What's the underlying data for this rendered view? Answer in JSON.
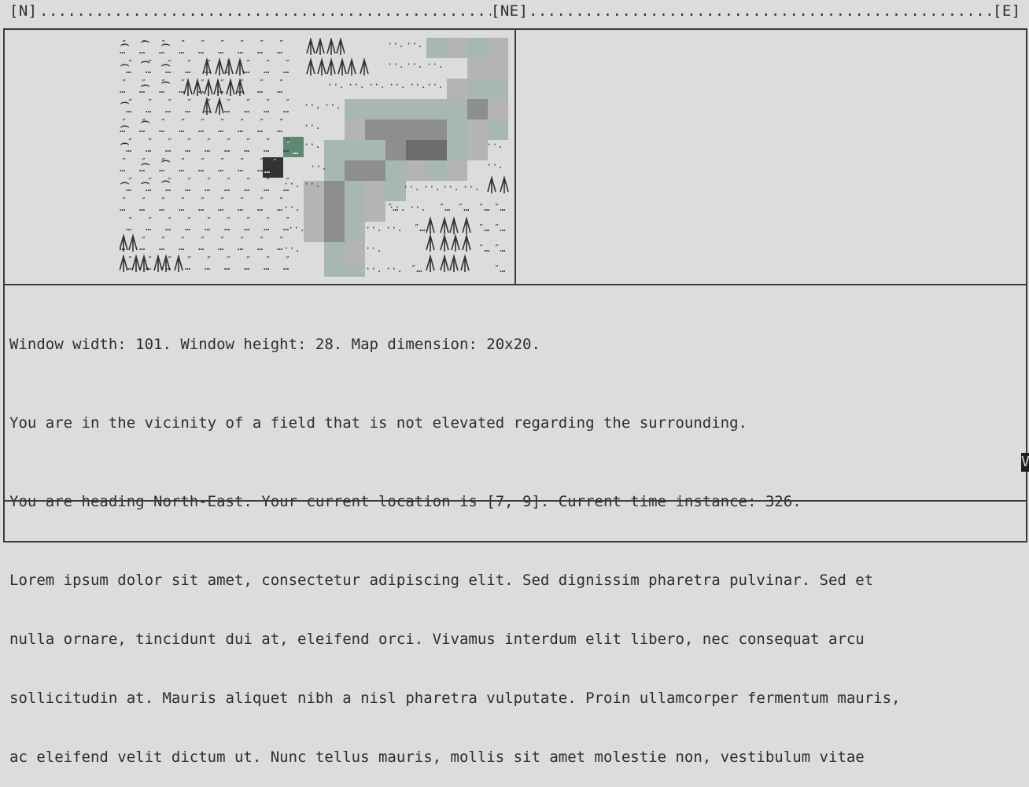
{
  "compass": {
    "left": "[N]",
    "center": "[NE]",
    "right": "[E]"
  },
  "map": {
    "dimension": "20x20",
    "rows": [
      "hhhhg ggggtttt gg ddddd",
      "hhhhgtttg gg tttt. ddddd",
      "hhhgtttt  gg  ddddddddd",
      "hhggtt ggg gg dd",
      "hgggggggg gggdd",
      "hggggggggg gPdd",
      "hhhhgggg gXdd",
      "hhhhggggggd",
      "gggggggggd",
      "gggggggggd",
      "tgggggggddd",
      "ttttggggggdd"
    ]
  },
  "info": {
    "dimensions_line": "Window width: 101. Window height: 28. Map dimension: 20x20.",
    "vicinity_line": "You are in the vicinity of a field that is not elevated regarding the surrounding.",
    "heading_line": "You are heading North-East. Your current location is [7, 9]. Current time instance: 326.",
    "lorem_lines": [
      "Lorem ipsum dolor sit amet, consectetur adipiscing elit. Sed dignissim pharetra pulvinar. Sed et",
      "nulla ornare, tincidunt dui at, eleifend orci. Vivamus interdum elit libero, nec consequat arcu",
      "sollicitudin at. Mauris aliquet nibh a nisl pharetra vulputate. Proin ullamcorper fermentum mauris,",
      "ac eleifend velit dictum ut. Nunc tellus mauris, mollis sit amet molestie non, vestibulum vitae"
    ]
  },
  "cursor_char": "V",
  "input": {
    "value": ""
  },
  "colors": {
    "background": "#dcdcdc",
    "text": "#2e2e2e",
    "water": "#a6b8b0",
    "rock_light": "#b4b4b4",
    "rock_mid": "#8e8e8e",
    "rock_dark": "#6c6c6c",
    "player": "#5e8a74",
    "marker": "#333333"
  }
}
